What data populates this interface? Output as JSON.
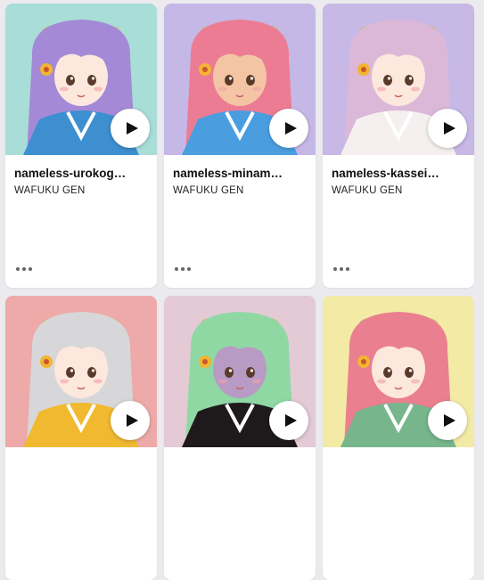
{
  "cards": [
    {
      "title": "nameless-urokog…",
      "artist": "WAFUKU GEN",
      "bg": "#a9ddd8",
      "hair": "#a48ad6",
      "robe": "#3d8fd0",
      "skin": "#fde8de"
    },
    {
      "title": "nameless-minam…",
      "artist": "WAFUKU GEN",
      "bg": "#c5b8e6",
      "hair": "#ec7c93",
      "robe": "#4a9ee0",
      "skin": "#f4c5a4"
    },
    {
      "title": "nameless-kassei…",
      "artist": "WAFUKU GEN",
      "bg": "#c7b8e6",
      "hair": "#dcb8d8",
      "robe": "#f5f0ef",
      "skin": "#fde8de"
    },
    {
      "title": "",
      "artist": "",
      "bg": "#eeaaa8",
      "hair": "#d7d7d9",
      "robe": "#f0b930",
      "skin": "#fde8de"
    },
    {
      "title": "",
      "artist": "",
      "bg": "#e3cad4",
      "hair": "#8fd8a4",
      "robe": "#1e1a1c",
      "skin": "#b89bc4"
    },
    {
      "title": "",
      "artist": "",
      "bg": "#f3eaa6",
      "hair": "#ea7f8f",
      "robe": "#77b68c",
      "skin": "#fde8de"
    }
  ],
  "icons": {
    "play": "play-icon",
    "more": "more-options-icon"
  }
}
